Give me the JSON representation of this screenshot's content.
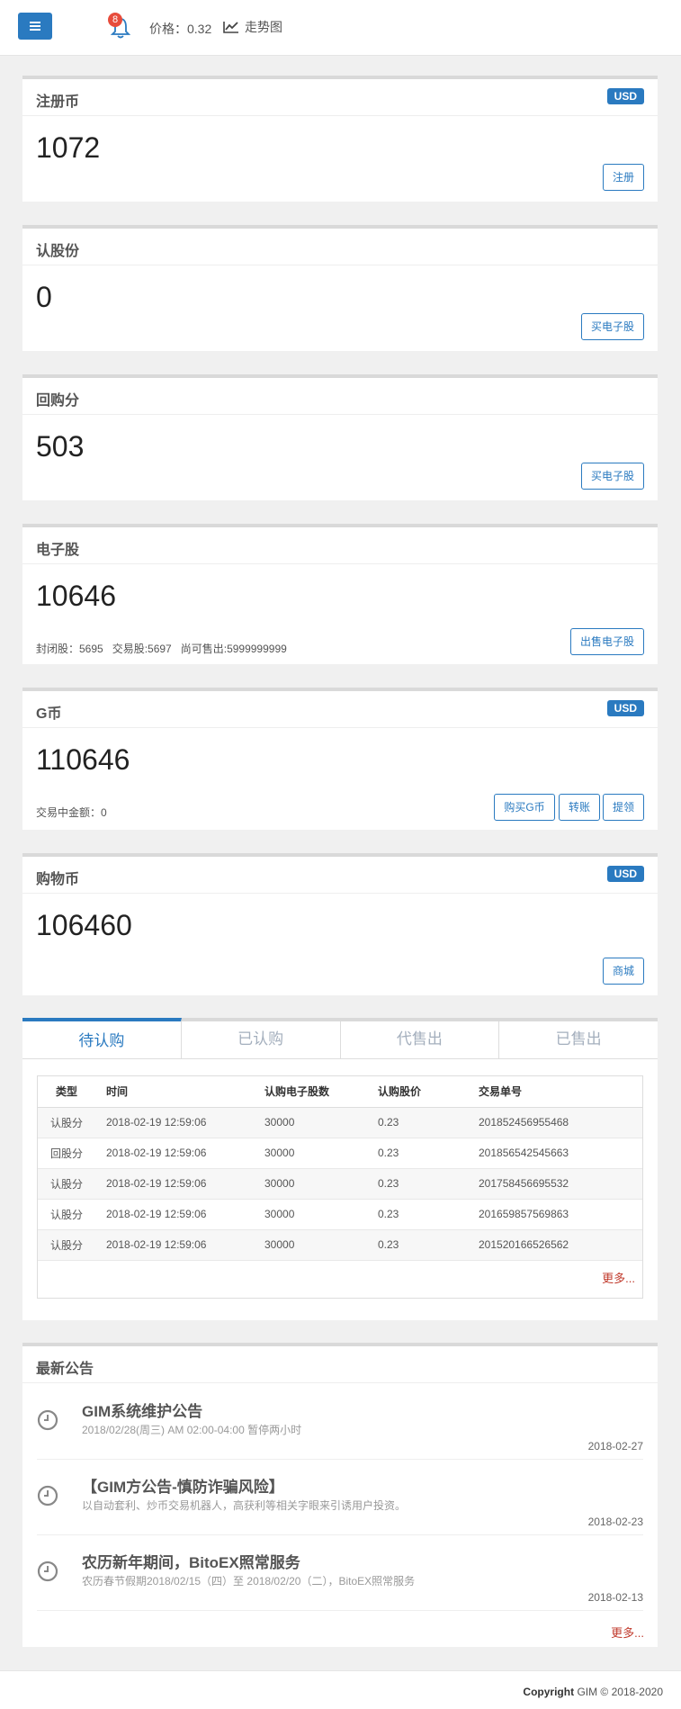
{
  "header": {
    "notification_count": "8",
    "price_label": "价格：0.32",
    "trend_label": "走势图"
  },
  "cards": [
    {
      "title": "注册币",
      "badge": "USD",
      "value": "1072",
      "buttons": [
        "注册"
      ]
    },
    {
      "title": "认股份",
      "value": "0",
      "buttons": [
        "买电子股"
      ]
    },
    {
      "title": "回购分",
      "value": "503",
      "buttons": [
        "买电子股"
      ]
    },
    {
      "title": "电子股",
      "value": "10646",
      "sub": "封闭股：5695   交易股:5697   尚可售出:5999999999",
      "buttons": [
        "出售电子股"
      ]
    },
    {
      "title": "G币",
      "badge": "USD",
      "value": "110646",
      "sub": "交易中金额：0",
      "buttons": [
        "购买G币",
        "转账",
        "提领"
      ]
    },
    {
      "title": "购物币",
      "badge": "USD",
      "value": "106460",
      "buttons": [
        "商城"
      ]
    }
  ],
  "tabs": [
    "待认购",
    "已认购",
    "代售出",
    "已售出"
  ],
  "table": {
    "headers": [
      "类型",
      "时间",
      "认购电子股数",
      "认购股价",
      "交易单号"
    ],
    "rows": [
      [
        "认股分",
        "2018-02-19 12:59:06",
        "30000",
        "0.23",
        "201852456955468"
      ],
      [
        "回股分",
        "2018-02-19 12:59:06",
        "30000",
        "0.23",
        "201856542545663"
      ],
      [
        "认股分",
        "2018-02-19 12:59:06",
        "30000",
        "0.23",
        "201758456695532"
      ],
      [
        "认股分",
        "2018-02-19 12:59:06",
        "30000",
        "0.23",
        "201659857569863"
      ],
      [
        "认股分",
        "2018-02-19 12:59:06",
        "30000",
        "0.23",
        "201520166526562"
      ]
    ],
    "more": "更多..."
  },
  "announcements": {
    "title": "最新公告",
    "items": [
      {
        "title": "GIM系统维护公告",
        "desc": "2018/02/28(周三) AM 02:00-04:00 暂停两小时",
        "date": "2018-02-27"
      },
      {
        "title": "【GIM方公告-慎防诈骗风险】",
        "desc": "以自动套利、炒币交易机器人，高获利等相关字眼来引诱用户投资。",
        "date": "2018-02-23"
      },
      {
        "title": "农历新年期间，BitoEX照常服务",
        "desc": "农历春节假期2018/02/15（四）至 2018/02/20（二），BitoEX照常服务",
        "date": "2018-02-13"
      }
    ],
    "more": "更多..."
  },
  "footer": {
    "copyright_word": "Copyright",
    "rest": "GIM © 2018-2020"
  },
  "colors": {
    "accent": "#2a7ac0",
    "more_link": "#c0392b",
    "badge_red": "#e74c3c"
  }
}
